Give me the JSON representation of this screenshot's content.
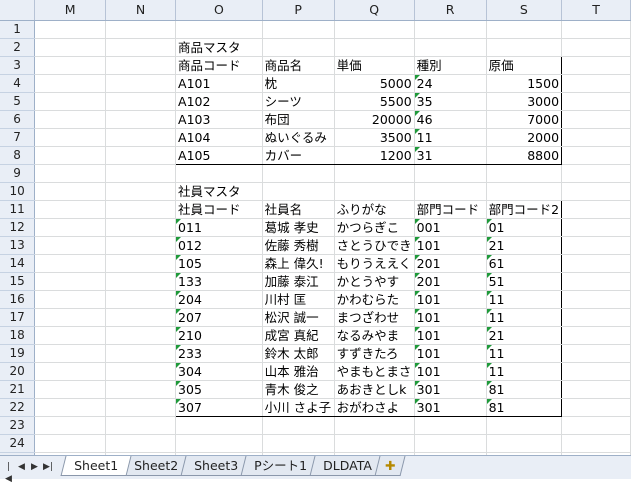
{
  "columns": [
    "M",
    "N",
    "O",
    "P",
    "Q",
    "R",
    "S",
    "T"
  ],
  "rows": [
    {
      "n": "1",
      "cells": []
    },
    {
      "n": "2",
      "cells": [
        {
          "c": "O",
          "text": "商品マスタ"
        }
      ]
    },
    {
      "n": "3",
      "cells": [
        {
          "c": "O",
          "text": "商品コード"
        },
        {
          "c": "P",
          "text": "商品名"
        },
        {
          "c": "Q",
          "text": "単価"
        },
        {
          "c": "R",
          "text": "種別"
        },
        {
          "c": "S",
          "text": "原価"
        }
      ]
    },
    {
      "n": "4",
      "cells": [
        {
          "c": "O",
          "text": "A101"
        },
        {
          "c": "P",
          "text": "枕"
        },
        {
          "c": "Q",
          "text": "5000"
        },
        {
          "c": "R",
          "text": "24"
        },
        {
          "c": "S",
          "text": "1500"
        }
      ]
    },
    {
      "n": "5",
      "cells": [
        {
          "c": "O",
          "text": "A102"
        },
        {
          "c": "P",
          "text": "シーツ"
        },
        {
          "c": "Q",
          "text": "5500"
        },
        {
          "c": "R",
          "text": "35"
        },
        {
          "c": "S",
          "text": "3000"
        }
      ]
    },
    {
      "n": "6",
      "cells": [
        {
          "c": "O",
          "text": "A103"
        },
        {
          "c": "P",
          "text": "布団"
        },
        {
          "c": "Q",
          "text": "20000"
        },
        {
          "c": "R",
          "text": "46"
        },
        {
          "c": "S",
          "text": "7000"
        }
      ]
    },
    {
      "n": "7",
      "cells": [
        {
          "c": "O",
          "text": "A104"
        },
        {
          "c": "P",
          "text": "ぬいぐるみ"
        },
        {
          "c": "Q",
          "text": "3500"
        },
        {
          "c": "R",
          "text": "11"
        },
        {
          "c": "S",
          "text": "2000"
        }
      ]
    },
    {
      "n": "8",
      "cells": [
        {
          "c": "O",
          "text": "A105"
        },
        {
          "c": "P",
          "text": "カバー"
        },
        {
          "c": "Q",
          "text": "1200"
        },
        {
          "c": "R",
          "text": "31"
        },
        {
          "c": "S",
          "text": "8800"
        }
      ]
    },
    {
      "n": "9",
      "cells": []
    },
    {
      "n": "10",
      "cells": [
        {
          "c": "O",
          "text": "社員マスタ"
        }
      ]
    },
    {
      "n": "11",
      "cells": [
        {
          "c": "O",
          "text": "社員コード"
        },
        {
          "c": "P",
          "text": "社員名"
        },
        {
          "c": "Q",
          "text": "ふりがな"
        },
        {
          "c": "R",
          "text": "部門コード"
        },
        {
          "c": "S",
          "text": "部門コード2"
        }
      ]
    },
    {
      "n": "12",
      "cells": [
        {
          "c": "O",
          "text": "011"
        },
        {
          "c": "P",
          "text": "葛城 孝史"
        },
        {
          "c": "Q",
          "text": "かつらぎこ"
        },
        {
          "c": "R",
          "text": "001"
        },
        {
          "c": "S",
          "text": "01"
        }
      ]
    },
    {
      "n": "13",
      "cells": [
        {
          "c": "O",
          "text": "012"
        },
        {
          "c": "P",
          "text": "佐藤 秀樹"
        },
        {
          "c": "Q",
          "text": "さとうひでき"
        },
        {
          "c": "R",
          "text": "101"
        },
        {
          "c": "S",
          "text": "21"
        }
      ]
    },
    {
      "n": "14",
      "cells": [
        {
          "c": "O",
          "text": "105"
        },
        {
          "c": "P",
          "text": "森上 偉久!"
        },
        {
          "c": "Q",
          "text": "もりうええく"
        },
        {
          "c": "R",
          "text": "201"
        },
        {
          "c": "S",
          "text": "61"
        }
      ]
    },
    {
      "n": "15",
      "cells": [
        {
          "c": "O",
          "text": "133"
        },
        {
          "c": "P",
          "text": "加藤 泰江"
        },
        {
          "c": "Q",
          "text": "かとうやす"
        },
        {
          "c": "R",
          "text": "201"
        },
        {
          "c": "S",
          "text": "51"
        }
      ]
    },
    {
      "n": "16",
      "cells": [
        {
          "c": "O",
          "text": "204"
        },
        {
          "c": "P",
          "text": "川村 匡"
        },
        {
          "c": "Q",
          "text": "かわむらた"
        },
        {
          "c": "R",
          "text": "101"
        },
        {
          "c": "S",
          "text": "11"
        }
      ]
    },
    {
      "n": "17",
      "cells": [
        {
          "c": "O",
          "text": "207"
        },
        {
          "c": "P",
          "text": "松沢 誠一"
        },
        {
          "c": "Q",
          "text": "まつざわせ"
        },
        {
          "c": "R",
          "text": "101"
        },
        {
          "c": "S",
          "text": "11"
        }
      ]
    },
    {
      "n": "18",
      "cells": [
        {
          "c": "O",
          "text": "210"
        },
        {
          "c": "P",
          "text": "成宮 真紀"
        },
        {
          "c": "Q",
          "text": "なるみやま"
        },
        {
          "c": "R",
          "text": "101"
        },
        {
          "c": "S",
          "text": "21"
        }
      ]
    },
    {
      "n": "19",
      "cells": [
        {
          "c": "O",
          "text": "233"
        },
        {
          "c": "P",
          "text": "鈴木 太郎"
        },
        {
          "c": "Q",
          "text": "すずきたろ"
        },
        {
          "c": "R",
          "text": "101"
        },
        {
          "c": "S",
          "text": "11"
        }
      ]
    },
    {
      "n": "20",
      "cells": [
        {
          "c": "O",
          "text": "304"
        },
        {
          "c": "P",
          "text": "山本 雅治"
        },
        {
          "c": "Q",
          "text": "やまもとまさ"
        },
        {
          "c": "R",
          "text": "101"
        },
        {
          "c": "S",
          "text": "11"
        }
      ]
    },
    {
      "n": "21",
      "cells": [
        {
          "c": "O",
          "text": "305"
        },
        {
          "c": "P",
          "text": "青木 俊之"
        },
        {
          "c": "Q",
          "text": "あおきとしk"
        },
        {
          "c": "R",
          "text": "301"
        },
        {
          "c": "S",
          "text": "81"
        }
      ]
    },
    {
      "n": "22",
      "cells": [
        {
          "c": "O",
          "text": "307"
        },
        {
          "c": "P",
          "text": "小川 さよ子"
        },
        {
          "c": "Q",
          "text": "おがわさよ"
        },
        {
          "c": "R",
          "text": "301"
        },
        {
          "c": "S",
          "text": "81"
        }
      ]
    },
    {
      "n": "23",
      "cells": []
    },
    {
      "n": "24",
      "cells": []
    },
    {
      "n": "25",
      "cells": []
    }
  ],
  "sheet_tabs": [
    "Sheet1",
    "Sheet2",
    "Sheet3",
    "Pシート1",
    "DLDATA"
  ],
  "active_tab": "Sheet1",
  "nav_icons": [
    "first-sheet-icon",
    "prev-sheet-icon",
    "next-sheet-icon",
    "last-sheet-icon"
  ],
  "new_sheet_icon": "insert-sheet-icon",
  "colors": {
    "header_bg": "#e9eef6",
    "gridline": "#dadcdd",
    "text_indicator": "#1f9a3a"
  }
}
